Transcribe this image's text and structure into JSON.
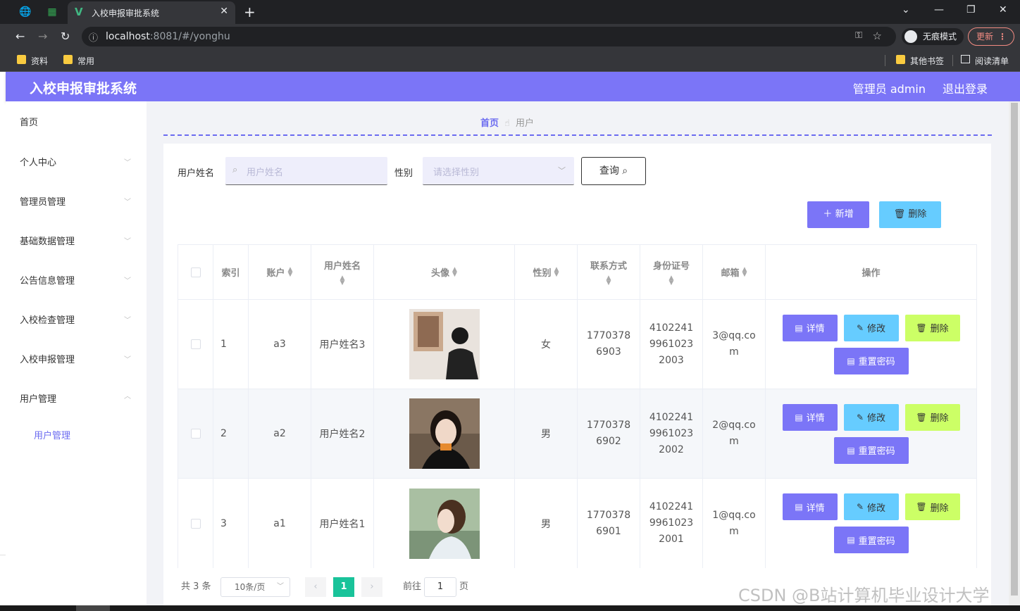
{
  "browser": {
    "tab_title": "入校申报审批系统",
    "url_host": "localhost",
    "url_rest": ":8081/#/yonghu",
    "incognito_label": "无痕模式",
    "update_label": "更新",
    "bookmarks": [
      "资料",
      "常用"
    ],
    "other_bookmarks": "其他书签",
    "reading_list": "阅读清单"
  },
  "header": {
    "title": "入校申报审批系统",
    "user": "管理员 admin",
    "logout": "退出登录"
  },
  "sidebar": {
    "items": [
      {
        "label": "首页"
      },
      {
        "label": "个人中心"
      },
      {
        "label": "管理员管理"
      },
      {
        "label": "基础数据管理"
      },
      {
        "label": "公告信息管理"
      },
      {
        "label": "入校检查管理"
      },
      {
        "label": "入校申报管理"
      },
      {
        "label": "用户管理"
      }
    ],
    "sub_item": "用户管理"
  },
  "breadcrumb": {
    "home": "首页",
    "current": "用户"
  },
  "search": {
    "name_label": "用户姓名",
    "name_placeholder": "用户姓名",
    "gender_label": "性别",
    "gender_placeholder": "请选择性别",
    "query_label": "查询"
  },
  "actions": {
    "add": "新增",
    "delete": "删除"
  },
  "table": {
    "headers": {
      "index": "索引",
      "account": "账户",
      "name": "用户姓名",
      "avatar": "头像",
      "gender": "性别",
      "phone": "联系方式",
      "idcard": "身份证号",
      "email": "邮箱",
      "ops": "操作"
    },
    "rows": [
      {
        "index": "1",
        "account": "a3",
        "name": "用户姓名3",
        "gender": "女",
        "phone": "17703786903",
        "idcard": "410224199610232003",
        "email": "3@qq.com"
      },
      {
        "index": "2",
        "account": "a2",
        "name": "用户姓名2",
        "gender": "男",
        "phone": "17703786902",
        "idcard": "410224199610232002",
        "email": "2@qq.com"
      },
      {
        "index": "3",
        "account": "a1",
        "name": "用户姓名1",
        "gender": "男",
        "phone": "17703786901",
        "idcard": "410224199610232001",
        "email": "1@qq.com"
      }
    ],
    "ops": {
      "detail": "详情",
      "edit": "修改",
      "delete": "删除",
      "reset": "重置密码"
    }
  },
  "pagination": {
    "total": "共 3 条",
    "page_size": "10条/页",
    "current": "1",
    "goto_label": "前往",
    "goto_value": "1",
    "page_suffix": "页"
  },
  "watermark": "CSDN @B站计算机毕业设计大学"
}
